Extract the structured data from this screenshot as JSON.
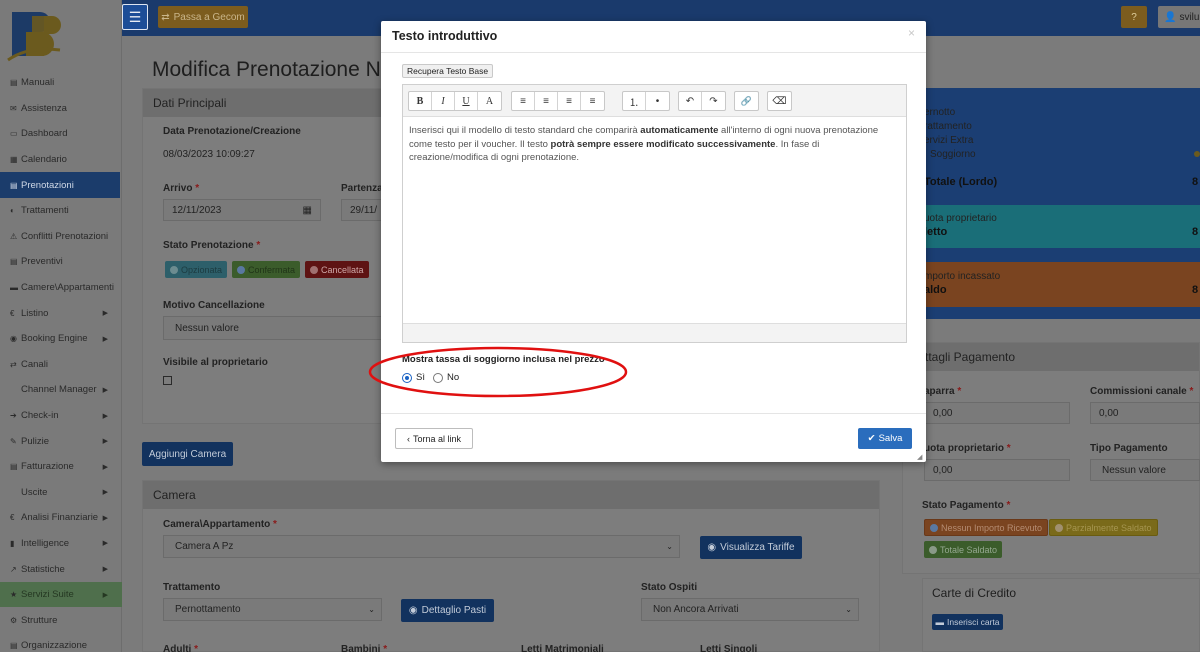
{
  "topbar": {
    "menu_icon": "☰",
    "gecom_label": "Passa a Gecom",
    "help_icon": "?",
    "user_label": "sviluppo"
  },
  "sidebar": {
    "items": [
      {
        "label": "Manuali",
        "icon": "▤"
      },
      {
        "label": "Assistenza",
        "icon": "✉"
      },
      {
        "label": "Dashboard",
        "icon": "▭"
      },
      {
        "label": "Calendario",
        "icon": "▦"
      },
      {
        "label": "Prenotazioni",
        "icon": "▤",
        "active": true
      },
      {
        "label": "Trattamenti",
        "icon": "◐"
      },
      {
        "label": "Conflitti Prenotazioni",
        "icon": "⚠"
      },
      {
        "label": "Preventivi",
        "icon": "▤"
      },
      {
        "label": "Camere\\Appartamenti",
        "icon": "▬"
      },
      {
        "label": "Listino",
        "icon": "€",
        "caret": true
      },
      {
        "label": "Booking Engine",
        "icon": "◉",
        "caret": true
      },
      {
        "label": "Canali",
        "icon": "⇄"
      },
      {
        "label": "Channel Manager",
        "icon": "",
        "caret": true
      },
      {
        "label": "Check-in",
        "icon": "➔",
        "caret": true
      },
      {
        "label": "Pulizie",
        "icon": "✎",
        "caret": true
      },
      {
        "label": "Fatturazione",
        "icon": "▤",
        "caret": true
      },
      {
        "label": "Uscite",
        "icon": "",
        "caret": true
      },
      {
        "label": "Analisi Finanziarie",
        "icon": "€",
        "caret": true
      },
      {
        "label": "Intelligence",
        "icon": "▮",
        "caret": true
      },
      {
        "label": "Statistiche",
        "icon": "↗",
        "caret": true
      },
      {
        "label": "Servizi Suite",
        "icon": "★",
        "caret": true,
        "green": true
      },
      {
        "label": "Strutture",
        "icon": "⚙"
      },
      {
        "label": "Organizzazione",
        "icon": "▤"
      }
    ]
  },
  "page": {
    "title": "Modifica Prenotazione N°",
    "dati_principali": "Dati Principali",
    "data_pren_label": "Data Prenotazione/Creazione",
    "data_pren_value": "08/03/2023 10:09:27",
    "arrivo_label": "Arrivo",
    "arrivo_value": "12/11/2023",
    "partenza_label": "Partenza",
    "partenza_value": "29/11/",
    "stato_label": "Stato Prenotazione",
    "stato_opz": "Opzionata",
    "stato_conf": "Confermata",
    "stato_canc": "Cancellata",
    "motivo_label": "Motivo Cancellazione",
    "motivo_value": "Nessun valore",
    "visibile_label": "Visibile al proprietario",
    "aggiungi_camera": "Aggiungi Camera",
    "camera_head": "Camera",
    "camera_label": "Camera\\Appartamento",
    "camera_value": "Camera A Pz",
    "visualizza_tariffe": "Visualizza Tariffe",
    "trattamento_label": "Trattamento",
    "trattamento_value": "Pernottamento",
    "dettaglio_pasti": "Dettaglio Pasti",
    "stato_ospiti_label": "Stato Ospiti",
    "stato_ospiti_value": "Non Ancora Arrivati",
    "adulti_label": "Adulti",
    "bambini_label": "Bambini",
    "letti_matr_label": "Letti Matrimoniali",
    "letti_sing_label": "Letti Singoli"
  },
  "right": {
    "pernotto": "ernotto",
    "trattamento": "rattamento",
    "servizi_extra": "ervizi Extra",
    "soggiorno": "Soggiorno",
    "totale_lordo": "Totale (Lordo)",
    "quota_prop": "uota proprietario",
    "netto": "letto",
    "importo_incassato": "mporto incassato",
    "saldo": "aldo",
    "val_8": "8",
    "dettagli_pagamento": "ttagli Pagamento",
    "caparra_label": "aparra",
    "caparra_value": "0,00",
    "commissioni_label": "Commissioni canale",
    "commissioni_value": "0,00",
    "quota_label": "uota proprietario",
    "quota_value": "0,00",
    "tipo_pag_label": "Tipo Pagamento",
    "tipo_pag_value": "Nessun valore",
    "stato_pag_label": "Stato Pagamento",
    "stato_nessun": "Nessun Importo Ricevuto",
    "stato_parz": "Parzialmente Saldato",
    "stato_totale": "Totale Saldato",
    "carte_credito": "Carte di Credito",
    "inserisci_carta": "Inserisci carta"
  },
  "modal": {
    "title": "Testo introduttivo",
    "close": "×",
    "recupera": "Recupera Testo Base",
    "toolbar": {
      "bold": "B",
      "italic": "I",
      "underline": "U",
      "font": "A",
      "align_left": "≡",
      "align_center": "≡",
      "align_right": "≡",
      "justify": "≡",
      "ol": "⒈",
      "ul": "•",
      "undo": "↶",
      "redo": "↷",
      "link": "🔗",
      "eraser": "⌫"
    },
    "text_1": "Inserisci qui il modello di testo standard che comparirà ",
    "text_bold_1": "automaticamente",
    "text_2": " all'interno di ogni nuova prenotazione come testo per il voucher. Il testo ",
    "text_bold_2": "potrà sempre essere modificato successivamente",
    "text_3": ". In fase di creazione/modifica di ogni prenotazione.",
    "tax_label": "Mostra tassa di soggiorno inclusa nel prezzo",
    "radio_si": "Sì",
    "radio_no": "No",
    "back_label": "Torna al link",
    "save_label": "Salva"
  },
  "colors": {
    "highlight_ellipse": "#e01010",
    "save": "#2a6dbd",
    "topbar": "#1a3a6c"
  }
}
